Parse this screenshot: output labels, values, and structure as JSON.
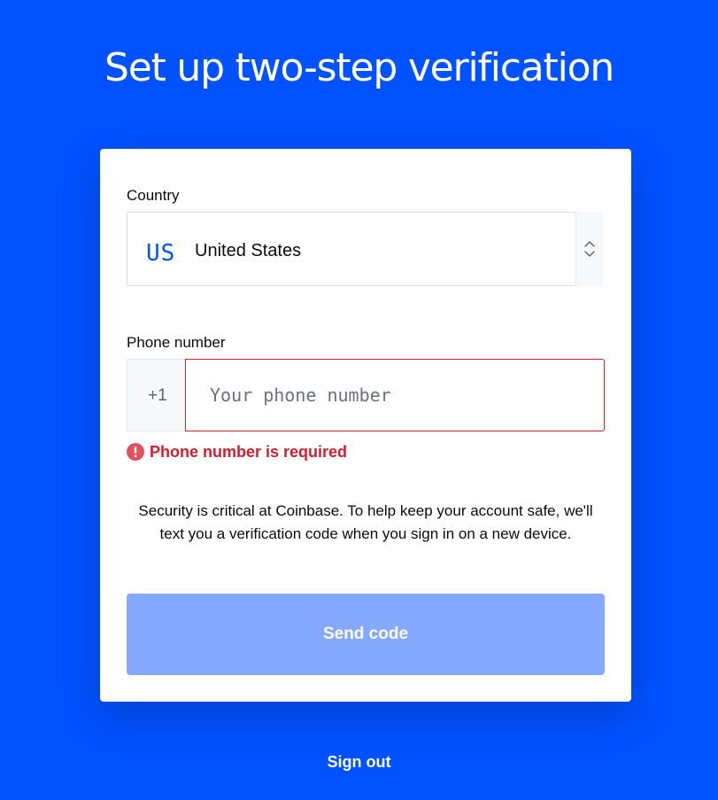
{
  "page": {
    "title": "Set up two-step verification"
  },
  "form": {
    "country_label": "Country",
    "country": {
      "code": "US",
      "name": "United States"
    },
    "phone_label": "Phone number",
    "phone_prefix": "+1",
    "phone_value": "",
    "phone_placeholder": "Your phone number",
    "error_icon": "exclamation-circle-icon",
    "error_message": "Phone number is required",
    "security_note": "Security is critical at Coinbase. To help keep your account safe, we'll text you a verification code when you sign in on a new device.",
    "send_button_label": "Send code",
    "send_button_disabled": true
  },
  "footer": {
    "sign_out_label": "Sign out"
  },
  "colors": {
    "background": "#0052ff",
    "card": "#ffffff",
    "accent": "#0052ff",
    "error": "#cf202f",
    "button_disabled": "#85a9ff"
  }
}
